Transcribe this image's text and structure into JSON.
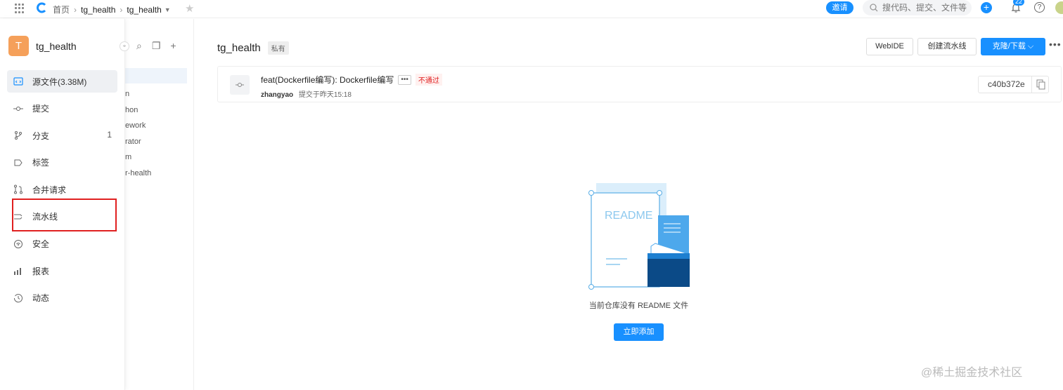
{
  "topbar": {
    "breadcrumb": [
      "首页",
      "tg_health",
      "tg_health"
    ],
    "invite_label": "邀请",
    "search_placeholder": "搜代码、提交、文件等",
    "notification_count": "22",
    "help_label": "?"
  },
  "sidebar": {
    "project_initial": "T",
    "project_name": "tg_health",
    "items": [
      {
        "label": "源文件(3.38M)",
        "icon": "source-icon",
        "active": true
      },
      {
        "label": "提交",
        "icon": "commit-icon"
      },
      {
        "label": "分支",
        "icon": "branch-icon",
        "count": "1"
      },
      {
        "label": "标签",
        "icon": "tag-icon"
      },
      {
        "label": "合并请求",
        "icon": "merge-request-icon"
      },
      {
        "label": "流水线",
        "icon": "pipeline-icon",
        "highlighted": true
      },
      {
        "label": "安全",
        "icon": "security-icon"
      },
      {
        "label": "报表",
        "icon": "report-icon"
      },
      {
        "label": "动态",
        "icon": "activity-icon"
      }
    ]
  },
  "tree": {
    "items": [
      "n",
      "hon",
      "ework",
      "rator",
      "m",
      "r-health"
    ]
  },
  "repo": {
    "name": "tg_health",
    "visibility": "私有",
    "webide_label": "WebIDE",
    "pipeline_label": "创建流水线",
    "clone_label": "克隆/下载 ⌵",
    "more": "•••"
  },
  "commit": {
    "message": "feat(Dockerfile编写): Dockerfile编写",
    "more": "•••",
    "status": "不通过",
    "author": "zhangyao",
    "time": "提交于昨天15:18",
    "sha": "c40b372e"
  },
  "readme": {
    "illustration_text": "README",
    "empty_text": "当前仓库没有 README 文件",
    "add_label": "立即添加"
  },
  "watermark": "@稀土掘金技术社区",
  "colors": {
    "primary": "#1890ff",
    "highlight": "#e02020",
    "avatar": "#f5a05a"
  }
}
